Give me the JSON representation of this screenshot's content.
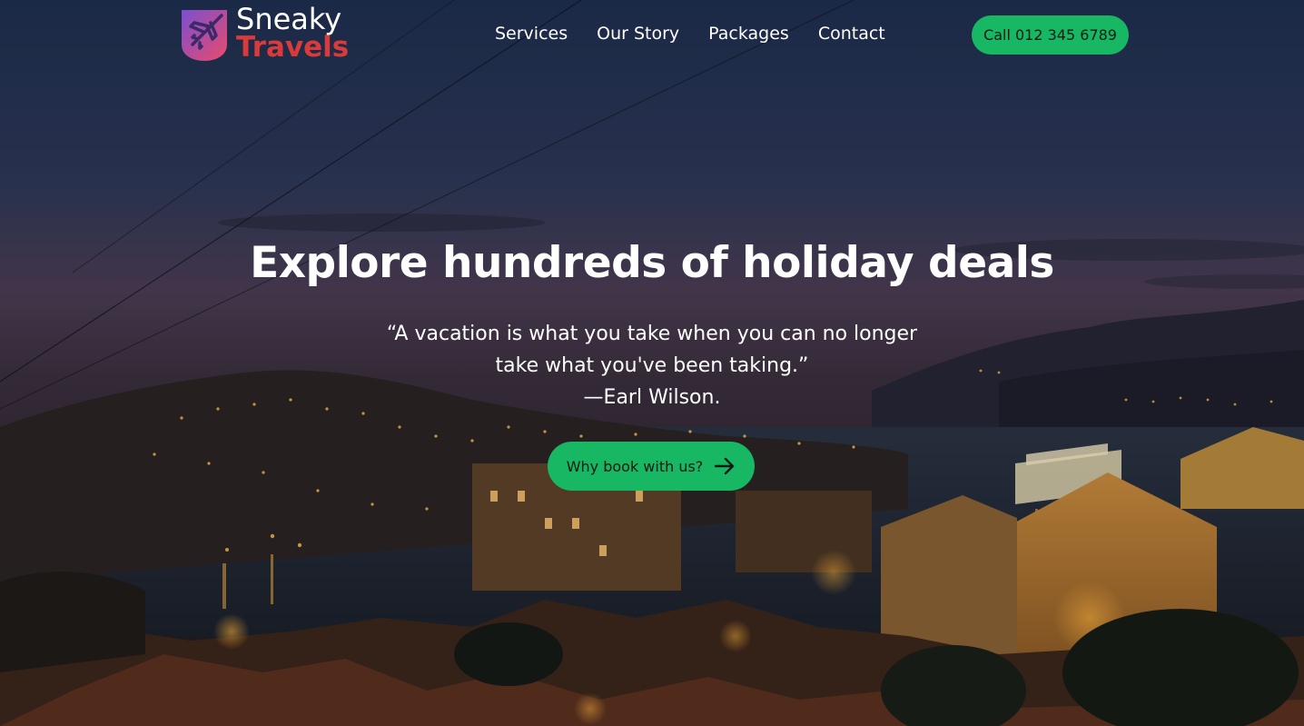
{
  "brand": {
    "name_line1": "Sneaky",
    "name_line2": "Travels",
    "colors": {
      "accent": "#18b764",
      "logo_red": "#d93a3a",
      "logo_gradient_start": "#7b4fd0",
      "logo_gradient_end": "#e94b6b"
    },
    "icon": "airplane-icon"
  },
  "nav": {
    "items": [
      {
        "label": "Services"
      },
      {
        "label": "Our Story"
      },
      {
        "label": "Packages"
      },
      {
        "label": "Contact"
      }
    ]
  },
  "header": {
    "call_label": "Call 012 345 6789"
  },
  "hero": {
    "headline": "Explore hundreds of holiday deals",
    "quote": "“A vacation is what you take when you can no longer take what you've been taking.”",
    "author": "—Earl Wilson.",
    "cta_label": "Why book with us?",
    "cta_icon": "arrow-right-icon",
    "background": "night-harbor-town-photo"
  }
}
